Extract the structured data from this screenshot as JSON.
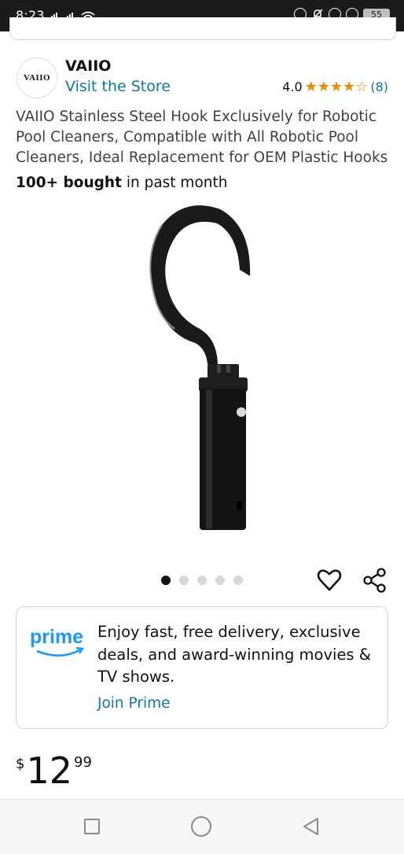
{
  "status_bar": {
    "time": "8:23",
    "battery": "55"
  },
  "brand": {
    "logo_text": "VAIIO",
    "name": "VAIIO",
    "visit_store": "Visit the Store"
  },
  "rating": {
    "value": "4.0",
    "stars": 4,
    "review_count": "(8)",
    "star_color": "#f08804"
  },
  "product": {
    "title": "VAIIO Stainless Steel Hook Exclusively for Robotic Pool Cleaners, Compatible with All Robotic Pool Cleaners, Ideal Replacement for OEM Plastic Hooks",
    "bought_bold": "100+ bought",
    "bought_rest": " in past month",
    "image_icon": "product-hook-image"
  },
  "carousel": {
    "total": 5,
    "active": 1
  },
  "prime": {
    "logo_text": "prime",
    "message": "Enjoy fast, free delivery, exclusive deals, and award-winning movies & TV shows.",
    "cta": "Join Prime",
    "brand_color": "#1a98ff"
  },
  "price": {
    "symbol": "$",
    "whole": "12",
    "fraction": "99"
  },
  "colors": {
    "link": "#0d7a9c",
    "text": "#0f1111"
  }
}
